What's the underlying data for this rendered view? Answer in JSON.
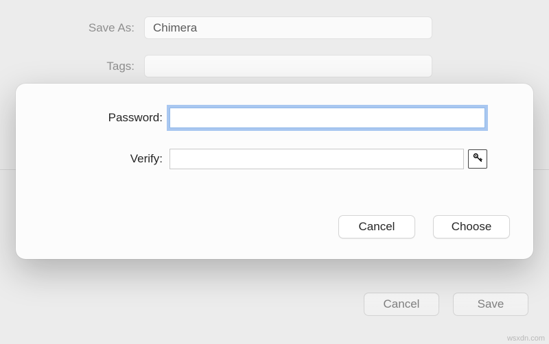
{
  "background": {
    "save_as_label": "Save As:",
    "save_as_value": "Chimera",
    "tags_label": "Tags:",
    "tags_value": "",
    "cancel_label": "Cancel",
    "save_label": "Save"
  },
  "modal": {
    "password_label": "Password:",
    "password_value": "",
    "verify_label": "Verify:",
    "verify_value": "",
    "cancel_label": "Cancel",
    "choose_label": "Choose"
  },
  "watermark": "wsxdn.com"
}
